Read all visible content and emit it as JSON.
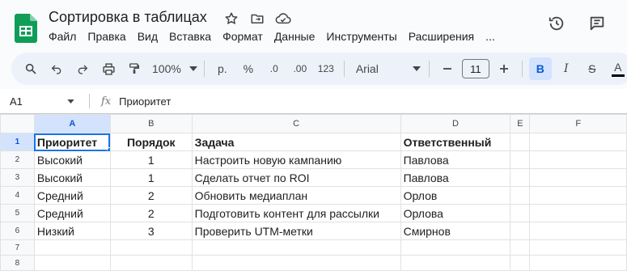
{
  "app": {
    "doc_title": "Сортировка в таблицах",
    "menu": [
      "Файл",
      "Правка",
      "Вид",
      "Вставка",
      "Формат",
      "Данные",
      "Инструменты",
      "Расширения",
      "..."
    ]
  },
  "toolbar": {
    "zoom": "100%",
    "currency": "р.",
    "percent": "%",
    "decimals_decrease": ".0",
    "decimals_increase": ".00",
    "number_format": "123",
    "font": "Arial",
    "font_size": "11",
    "bold": "B",
    "italic": "I",
    "strike": "S",
    "text_color_letter": "A"
  },
  "formula_bar": {
    "cell_ref": "A1",
    "fx": "fx",
    "value": "Приоритет"
  },
  "sheet": {
    "columns": [
      "A",
      "B",
      "C",
      "D",
      "E",
      "F"
    ],
    "row_numbers": [
      "1",
      "2",
      "3",
      "4",
      "5",
      "6",
      "7",
      "8"
    ],
    "rows": [
      [
        "Приоритет",
        "Порядок",
        "Задача",
        "Ответственный",
        "",
        ""
      ],
      [
        "Высокий",
        "1",
        "Настроить новую кампанию",
        "Павлова",
        "",
        ""
      ],
      [
        "Высокий",
        "1",
        "Сделать отчет по ROI",
        "Павлова",
        "",
        ""
      ],
      [
        "Средний",
        "2",
        "Обновить медиаплан",
        "Орлов",
        "",
        ""
      ],
      [
        "Средний",
        "2",
        "Подготовить контент для рассылки",
        "Орлова",
        "",
        ""
      ],
      [
        "Низкий",
        "3",
        "Проверить UTM-метки",
        "Смирнов",
        "",
        ""
      ],
      [
        "",
        "",
        "",
        "",
        "",
        ""
      ],
      [
        "",
        "",
        "",
        "",
        "",
        ""
      ]
    ]
  }
}
